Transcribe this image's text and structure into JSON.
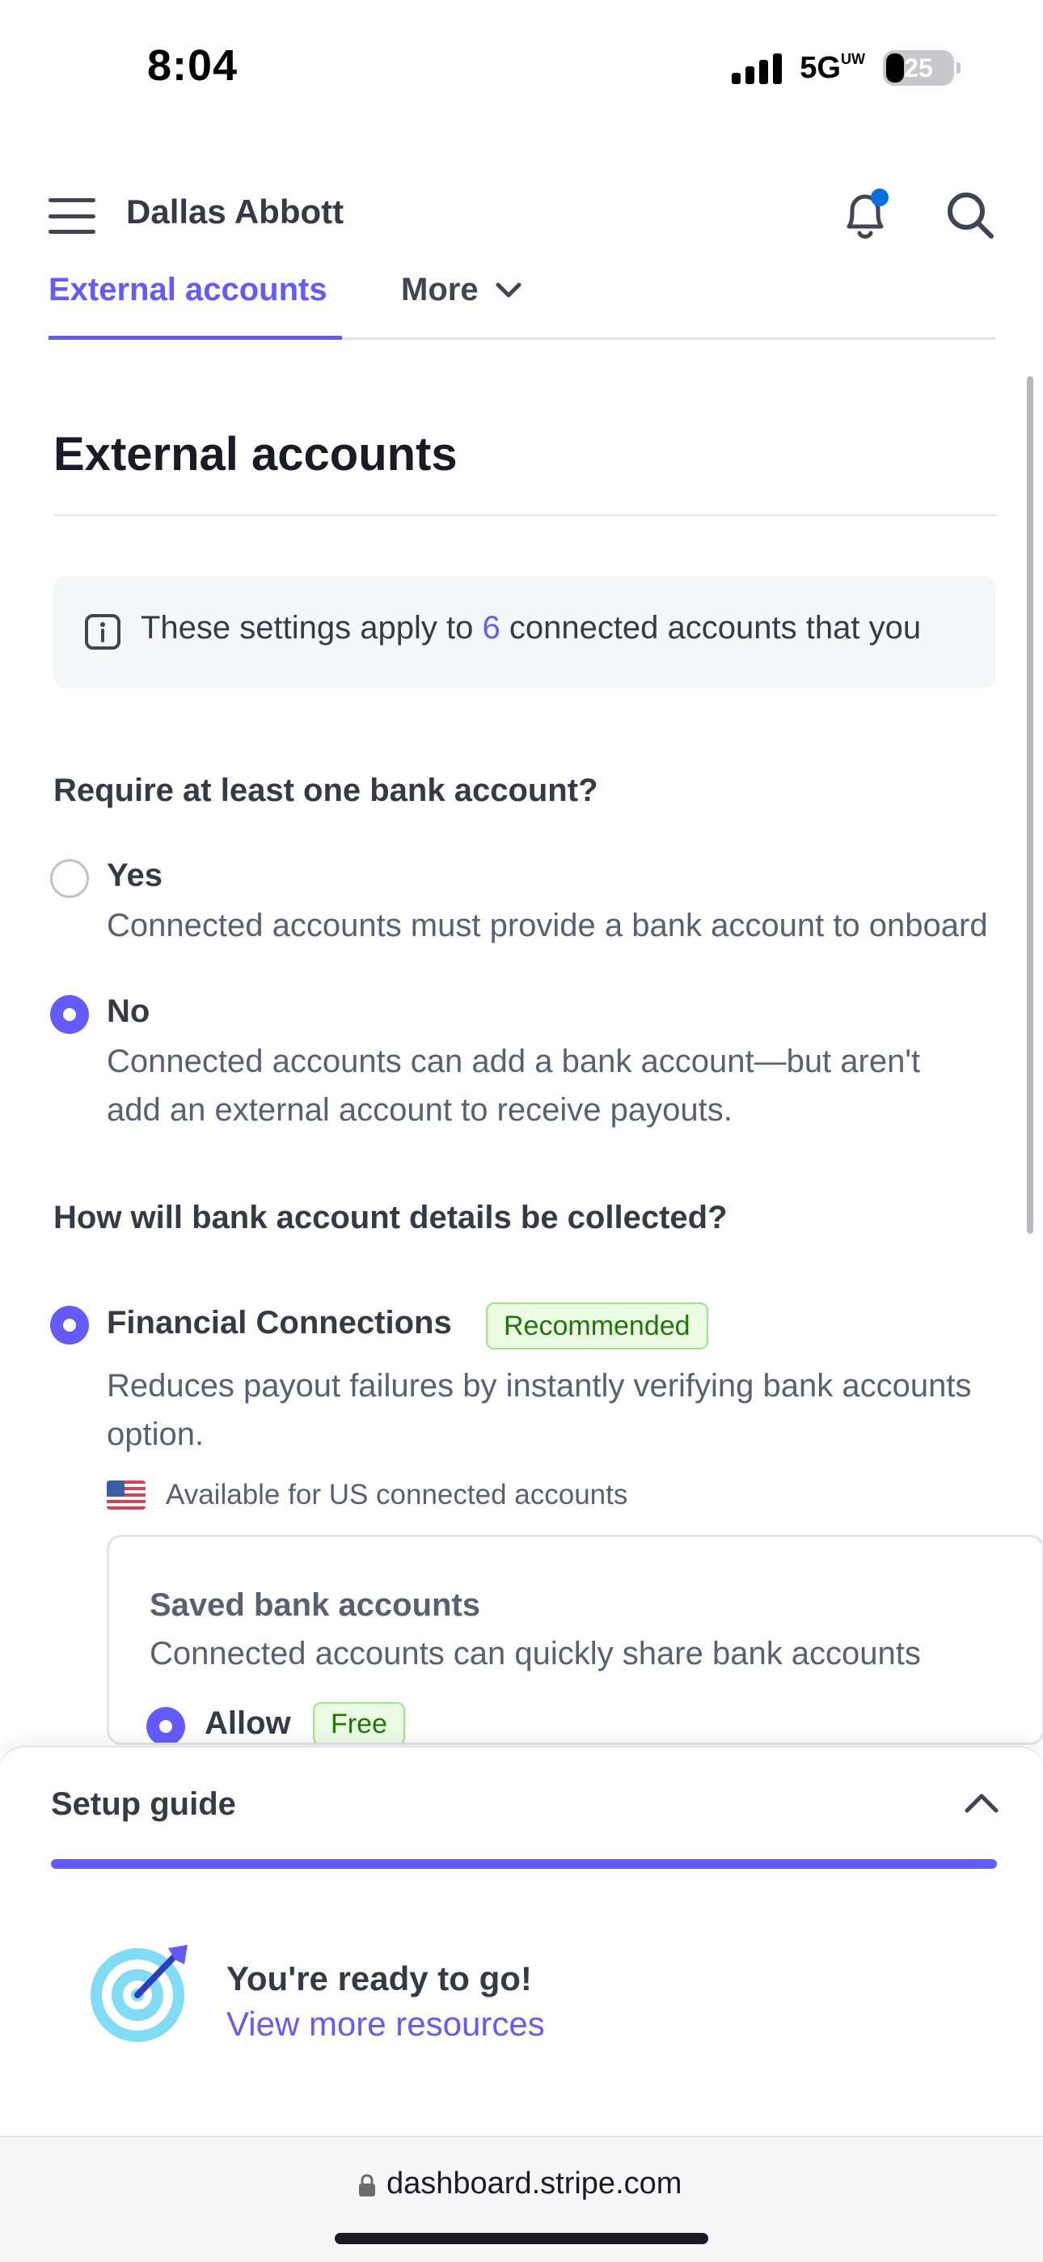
{
  "status_bar": {
    "time": "8:04",
    "network": "5G",
    "network_suffix": "UW",
    "battery": "25"
  },
  "header": {
    "account_name": "Dallas Abbott",
    "notification_dot_color": "#0570de"
  },
  "tabs": {
    "active": "External accounts",
    "more": "More"
  },
  "page": {
    "title": "External accounts"
  },
  "info_banner": {
    "prefix": "These settings apply to ",
    "count": "6",
    "suffix": " connected accounts that you"
  },
  "require_bank": {
    "question": "Require at least one bank account?",
    "options": [
      {
        "label": "Yes",
        "selected": false,
        "desc": [
          "Connected accounts must provide a bank account to onboard"
        ]
      },
      {
        "label": "No",
        "selected": true,
        "desc": [
          "Connected accounts can add a bank account—but aren't",
          "add an external account to receive payouts."
        ]
      }
    ]
  },
  "collection": {
    "question": "How will bank account details be collected?",
    "option": {
      "label": "Financial Connections",
      "badge": "Recommended",
      "selected": true,
      "desc": [
        "Reduces payout failures by instantly verifying bank accounts",
        "option."
      ],
      "availability": "Available for US connected accounts"
    },
    "saved_accounts": {
      "title": "Saved bank accounts",
      "desc": "Connected accounts can quickly share bank accounts",
      "allow_label": "Allow",
      "allow_badge": "Free"
    }
  },
  "setup_guide": {
    "title": "Setup guide",
    "progress": 1.0,
    "ready_title": "You're ready to go!",
    "resources_link": "View more resources"
  },
  "browser": {
    "url": "dashboard.stripe.com"
  },
  "colors": {
    "accent": "#635bff",
    "success_bg": "#ecfbe4",
    "success_text": "#21760a"
  }
}
